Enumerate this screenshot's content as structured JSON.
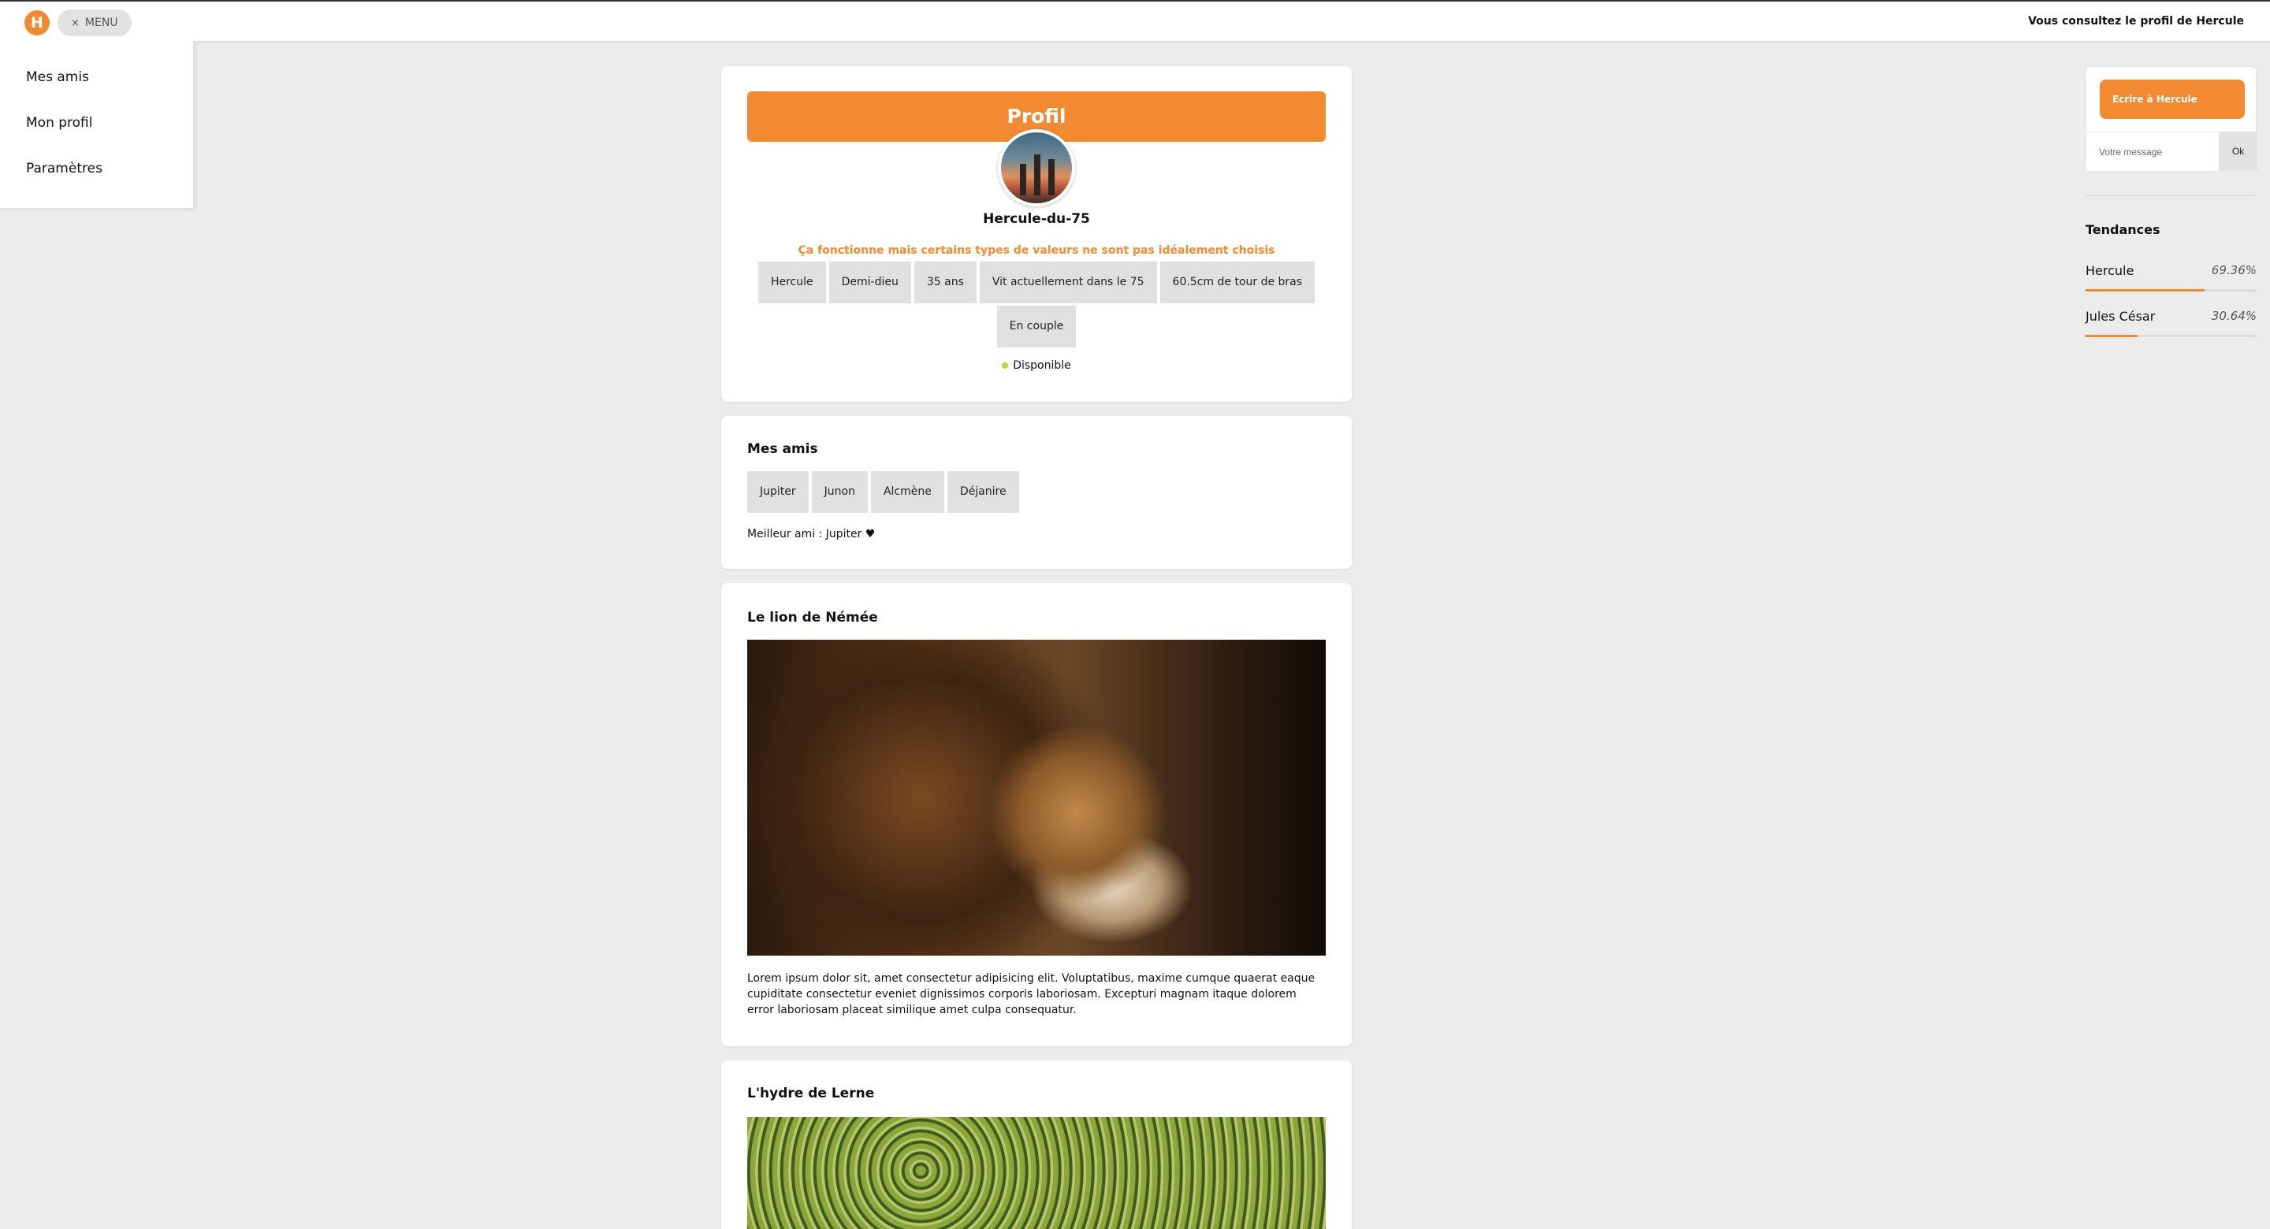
{
  "topbar": {
    "logo_letter": "H",
    "menu_toggle": "MENU",
    "menu_close_glyph": "×",
    "viewing_text": "Vous consultez le profil de Hercule"
  },
  "sidemenu": {
    "items": [
      {
        "label": "Mes amis"
      },
      {
        "label": "Mon profil"
      },
      {
        "label": "Paramètres"
      }
    ]
  },
  "profile": {
    "banner": "Profil",
    "username": "Hercule-du-75",
    "warning": "Ça fonctionne mais certains types de valeurs ne sont pas idéalement choisis",
    "tags": [
      "Hercule",
      "Demi-dieu",
      "35 ans",
      "Vit actuellement dans le 75",
      "60.5cm de tour de bras",
      "En couple"
    ],
    "status": "Disponible",
    "status_color": "#a6e22e"
  },
  "friends": {
    "title": "Mes amis",
    "list": [
      "Jupiter",
      "Junon",
      "Alcmène",
      "Déjanire"
    ],
    "best_friend": "Meilleur ami : Jupiter ♥"
  },
  "posts": [
    {
      "title": "Le lion de Némée",
      "image": "lion-photo",
      "text": "Lorem ipsum dolor sit, amet consectetur adipisicing elit. Voluptatibus, maxime cumque quaerat eaque cupiditate consectetur eveniet dignissimos corporis laboriosam. Excepturi magnam itaque dolorem error laboriosam placeat similique amet culpa consequatur."
    },
    {
      "title": "L'hydre de Lerne",
      "image": "hydra-photo"
    }
  ],
  "message": {
    "button": "Ecrire à Hercule",
    "placeholder": "Votre message",
    "ok": "Ok"
  },
  "trends": {
    "title": "Tendances",
    "items": [
      {
        "name": "Hercule",
        "percent": "69.36%",
        "fraction": 0.6936
      },
      {
        "name": "Jules César",
        "percent": "30.64%",
        "fraction": 0.3064
      }
    ]
  },
  "colors": {
    "accent": "#f28a32",
    "background": "#ececec",
    "tag_bg": "#e0e0e0"
  }
}
